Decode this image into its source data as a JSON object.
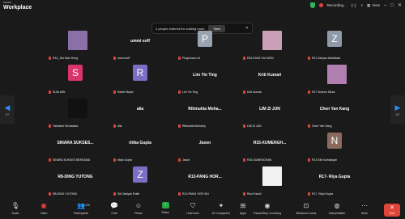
{
  "app": {
    "brand_small": "zoom",
    "brand_big": "Workplace"
  },
  "topbar": {
    "recording": "Recording...",
    "view": "View"
  },
  "banner": {
    "text": "2 people entered the waiting room",
    "view": "View"
  },
  "nav": {
    "left_page": "6/7",
    "right_page": "6/7"
  },
  "tiles": [
    {
      "label": "R14_Tan Man Hong",
      "photo": "#8a6fa8",
      "center": ""
    },
    {
      "label": "ummi soff",
      "center": "ummi soff"
    },
    {
      "label": "Pingchuan Lei",
      "avatar": "P",
      "avatar_color": "#9aa3b0"
    },
    {
      "label": "R16 IONG HUI WEN",
      "photo": "#c9a0b8"
    },
    {
      "label": "R11 Zaeyan Abdulbasi",
      "avatar": "Z",
      "avatar_color": "#8f9aaa"
    },
    {
      "label": "SUIA MIN",
      "avatar": "S",
      "avatar_color": "#d9356a"
    },
    {
      "label": "Rahel Mayer",
      "avatar": "R",
      "avatar_color": "#7a6fc4"
    },
    {
      "label": "Lim Yin Ting",
      "center": "Lim Yin Ting"
    },
    {
      "label": "Kriti Kumari",
      "center": "Kriti Kumari"
    },
    {
      "label": "R17 Noreen Mirza",
      "photo": "#b07fb0"
    },
    {
      "label": "Yashasvi Srivastava",
      "photo": "#111111"
    },
    {
      "label": "alia",
      "center": "alia"
    },
    {
      "label": "Ritimukta Mohanty",
      "center": "Ritimukta Moha..."
    },
    {
      "label": "LIM ZI JUN",
      "center": "LIM ZI JUN"
    },
    {
      "label": "Chen Yan Kang",
      "center": "Chen Yan Kang"
    },
    {
      "label": "SINARA SUKSES BERSAMA",
      "center": "SINARA SUKSES..."
    },
    {
      "label": "ritika Gupta",
      "center": "ritika Gupta"
    },
    {
      "label": "Jason",
      "center": "Jason"
    },
    {
      "label": "R15-XUMENGHAN",
      "center": "R15-XUMENGH..."
    },
    {
      "label": "R13 Siti Nurhidayah",
      "avatar": "N",
      "avatar_color": "#8a6a5a"
    },
    {
      "label": "R8-DING YUTONG",
      "center": "R8-DING YUTONG"
    },
    {
      "label": "Siti Zakiyah Rofie",
      "avatar": "Z",
      "avatar_color": "#7a6fc4"
    },
    {
      "label": "R13-PANG HOR XIN",
      "center": "R13-PANG HOR..."
    },
    {
      "label": "Rina Fadzil",
      "photo": "#f2f2f2"
    },
    {
      "label": "R17- Riya Gupta",
      "center": "R17- Riya Gupta"
    }
  ],
  "toolbar": {
    "audio": "Audio",
    "video": "Video",
    "participants": "Participants",
    "participants_count": "233",
    "chat": "Chat",
    "react": "React",
    "share": "Share",
    "host_tools": "Host tools",
    "ai_companion": "AI Companion",
    "apps": "Apps",
    "recording": "Pause/Stop recording",
    "breakout": "Breakout rooms",
    "interpretation": "Interpretation",
    "more": "More",
    "end": "End"
  }
}
